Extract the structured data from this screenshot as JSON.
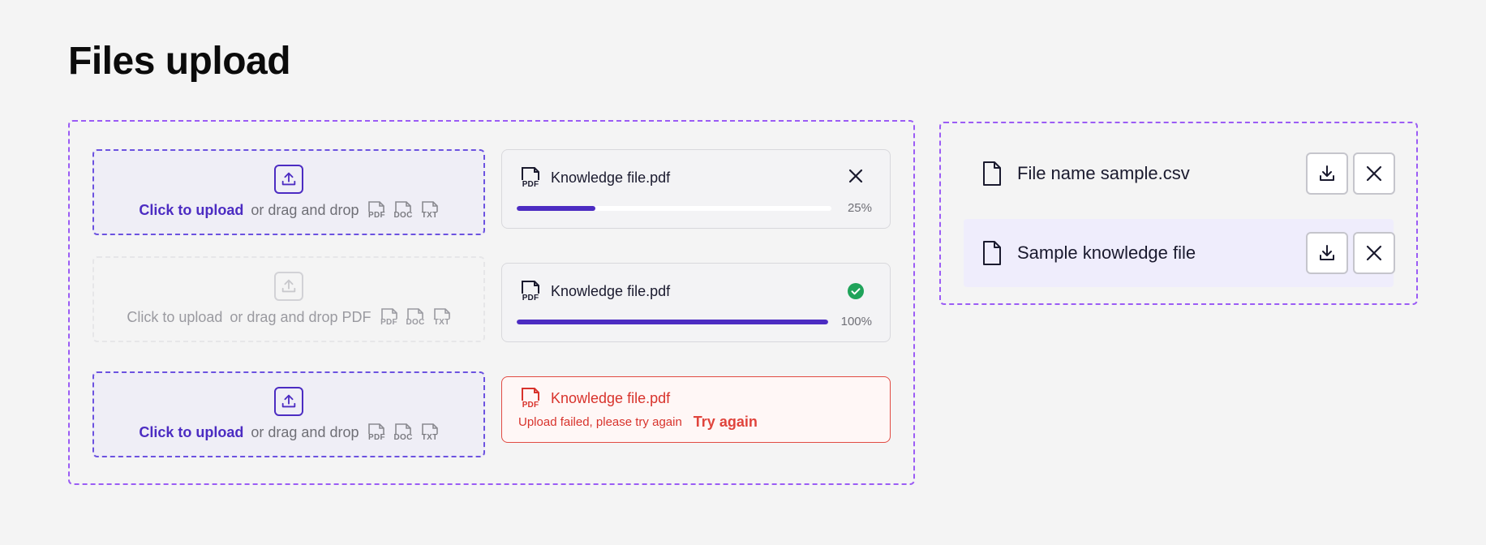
{
  "page": {
    "title": "Files upload"
  },
  "dropzones": [
    {
      "cta": "Click to upload",
      "rest": "or drag and drop",
      "types": [
        "PDF",
        "DOC",
        "TXT"
      ],
      "state": "active"
    },
    {
      "cta": "Click to upload",
      "rest": "or drag and drop PDF",
      "types": [
        "PDF",
        "DOC",
        "TXT"
      ],
      "state": "disabled"
    },
    {
      "cta": "Click to upload",
      "rest": "or drag and drop",
      "types": [
        "PDF",
        "DOC",
        "TXT"
      ],
      "state": "active"
    }
  ],
  "files": [
    {
      "name": "Knowledge file.pdf",
      "icon_label": "PDF",
      "progress": 25,
      "progress_label": "25%",
      "status": "uploading"
    },
    {
      "name": "Knowledge file.pdf",
      "icon_label": "PDF",
      "progress": 100,
      "progress_label": "100%",
      "status": "complete"
    },
    {
      "name": "Knowledge file.pdf",
      "icon_label": "PDF",
      "status": "error",
      "error_text": "Upload failed, please try again",
      "retry_label": "Try again"
    }
  ],
  "file_list": [
    {
      "name": "File name sample.csv",
      "highlighted": false
    },
    {
      "name": "Sample knowledge file",
      "highlighted": true
    }
  ],
  "colors": {
    "accent": "#4c2cc2",
    "group_border": "#9b5cf5",
    "success": "#1fa35a",
    "error": "#d8332c",
    "highlight_row": "#efedfc"
  }
}
